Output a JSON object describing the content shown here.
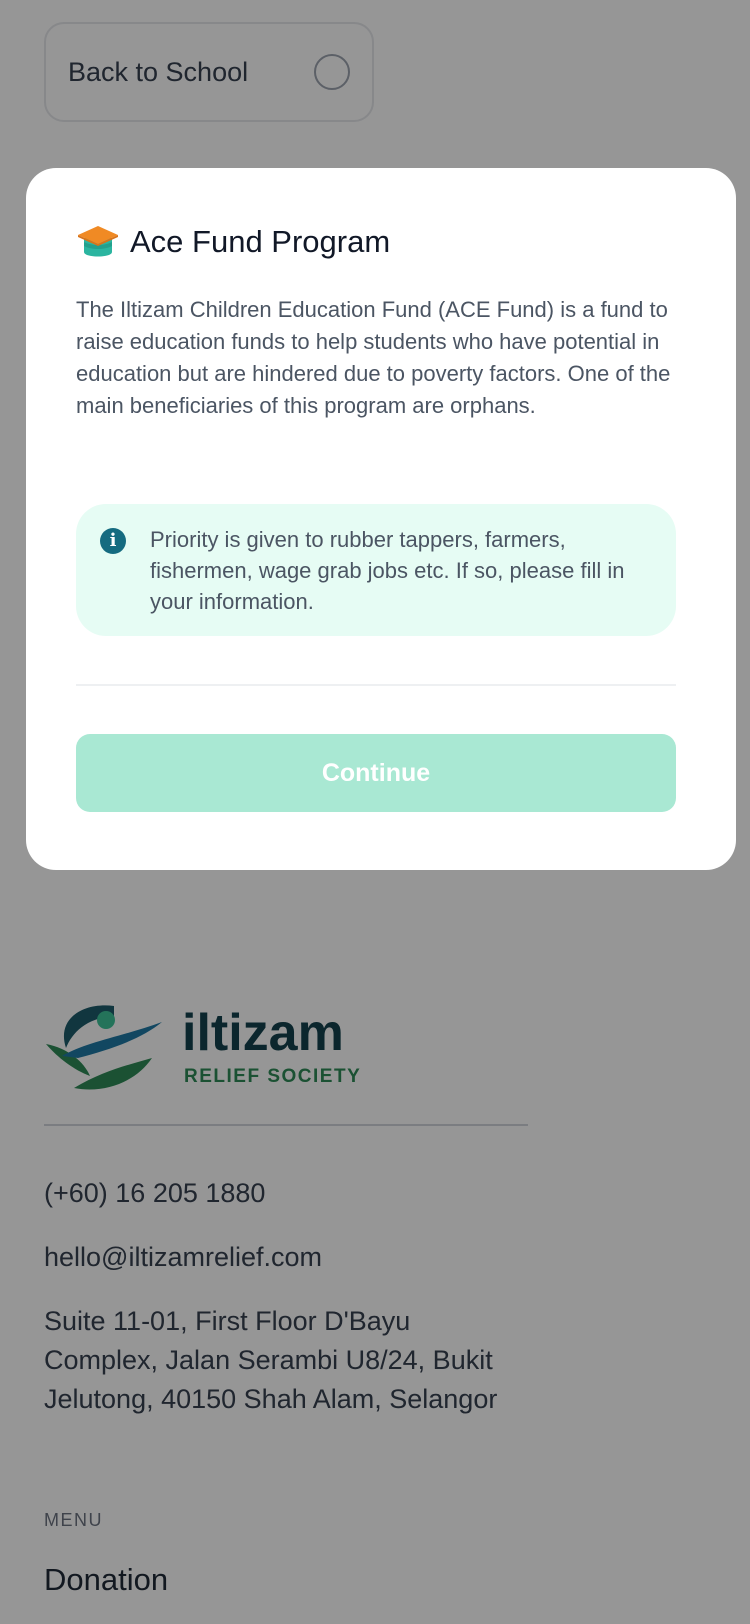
{
  "option_card": {
    "label": "Back to School"
  },
  "modal": {
    "title": "Ace Fund Program",
    "description": "The Iltizam Children Education Fund (ACE Fund) is a fund to raise education funds to help students who have potential in education but are hindered due to poverty factors. One of the main beneficiaries of this program are orphans.",
    "info": "Priority is given to rubber tappers, farmers, fishermen, wage grab jobs etc. If so, please fill in your information.",
    "continue_label": "Continue"
  },
  "footer": {
    "logo_name": "iltizam",
    "logo_tagline": "RELIEF SOCIETY",
    "phone": "(+60) 16 205 1880",
    "email": "hello@iltizamrelief.com",
    "address": "Suite 11-01, First Floor D'Bayu Complex, Jalan Serambi U8/24, Bukit Jelutong, 40150 Shah Alam, Selangor",
    "menu_heading": "MENU",
    "menu_items": [
      "Donation"
    ]
  },
  "colors": {
    "accent_teal": "#156b80",
    "brand_green": "#2e8b57",
    "button_disabled": "#a9e8d3",
    "info_bg": "#e6fcf4",
    "cap_orange": "#f08a24"
  },
  "icons": {
    "option_radio": "radio-unchecked-icon",
    "modal_title": "graduation-cap-icon",
    "info": "info-icon"
  }
}
